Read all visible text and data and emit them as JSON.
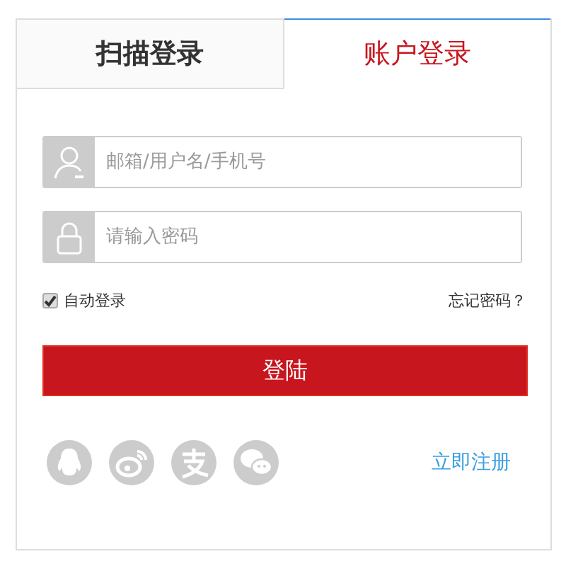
{
  "tabs": [
    {
      "label": "扫描登录",
      "selected": false
    },
    {
      "label": "账户登录",
      "selected": true
    }
  ],
  "fields": [
    {
      "kind": "user",
      "placeholder": "邮箱/用户名/手机号"
    },
    {
      "kind": "password",
      "placeholder": "请输入密码"
    }
  ],
  "remember": {
    "label": "自动登录",
    "checked": true
  },
  "forgot_link": "忘记密码？",
  "login_button": "登陆",
  "social": [
    {
      "kind": "penguin"
    },
    {
      "kind": "weibo"
    },
    {
      "kind": "pay"
    },
    {
      "kind": "chat"
    }
  ],
  "register_link": "立即注册"
}
